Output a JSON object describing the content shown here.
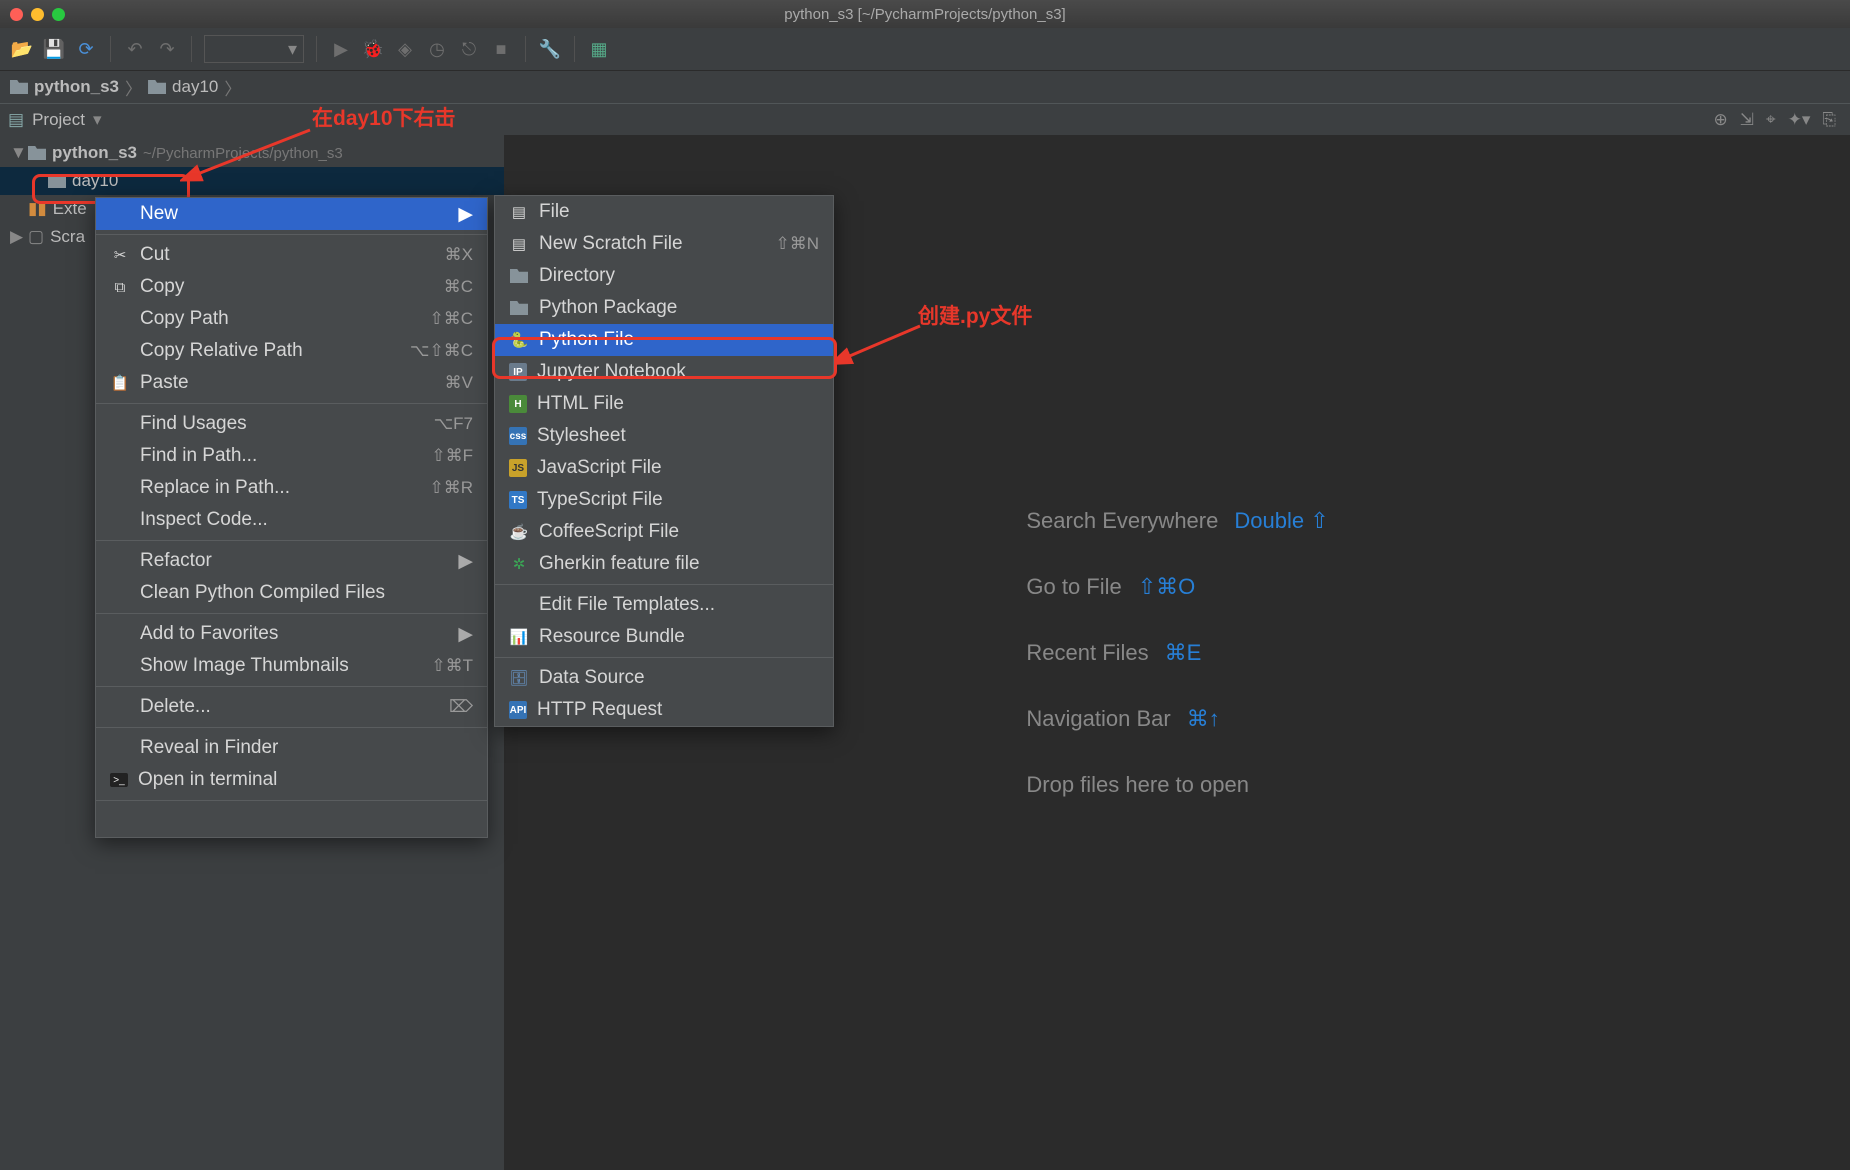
{
  "titlebar": {
    "title": "python_s3 [~/PycharmProjects/python_s3]"
  },
  "breadcrumb": {
    "root": "python_s3",
    "child": "day10"
  },
  "project_panel": {
    "label": "Project"
  },
  "tree": {
    "root": "python_s3",
    "root_path": "~/PycharmProjects/python_s3",
    "folder": "day10",
    "external": "Exte",
    "scratches": "Scra"
  },
  "context_menu": {
    "new": "New",
    "cut": {
      "label": "Cut",
      "shortcut": "⌘X"
    },
    "copy": {
      "label": "Copy",
      "shortcut": "⌘C"
    },
    "copy_path": {
      "label": "Copy Path",
      "shortcut": "⇧⌘C"
    },
    "copy_relative_path": {
      "label": "Copy Relative Path",
      "shortcut": "⌥⇧⌘C"
    },
    "paste": {
      "label": "Paste",
      "shortcut": "⌘V"
    },
    "find_usages": {
      "label": "Find Usages",
      "shortcut": "⌥F7"
    },
    "find_in_path": {
      "label": "Find in Path...",
      "shortcut": "⇧⌘F"
    },
    "replace_in_path": {
      "label": "Replace in Path...",
      "shortcut": "⇧⌘R"
    },
    "inspect_code": {
      "label": "Inspect Code..."
    },
    "refactor": {
      "label": "Refactor"
    },
    "clean_python": {
      "label": "Clean Python Compiled Files"
    },
    "add_to_favorites": {
      "label": "Add to Favorites"
    },
    "show_image_thumbnails": {
      "label": "Show Image Thumbnails",
      "shortcut": "⇧⌘T"
    },
    "delete": {
      "label": "Delete...",
      "shortcut": "⌦"
    },
    "reveal_in_finder": {
      "label": "Reveal in Finder"
    },
    "open_in_terminal": {
      "label": "Open in terminal"
    }
  },
  "new_submenu": {
    "file": "File",
    "new_scratch_file": {
      "label": "New Scratch File",
      "shortcut": "⇧⌘N"
    },
    "directory": "Directory",
    "python_package": "Python Package",
    "python_file": "Python File",
    "jupyter_notebook": "Jupyter Notebook",
    "html_file": "HTML File",
    "stylesheet": "Stylesheet",
    "javascript_file": "JavaScript File",
    "typescript_file": "TypeScript File",
    "coffeescript_file": "CoffeeScript File",
    "gherkin_feature_file": "Gherkin feature file",
    "edit_file_templates": "Edit File Templates...",
    "resource_bundle": "Resource Bundle",
    "data_source": "Data Source",
    "http_request": "HTTP Request"
  },
  "welcome": {
    "search_everywhere": "Search Everywhere",
    "search_everywhere_key": "Double ⇧",
    "go_to_file": "Go to File",
    "go_to_file_key": "⇧⌘O",
    "recent_files": "Recent Files",
    "recent_files_key": "⌘E",
    "navigation_bar": "Navigation Bar",
    "navigation_bar_key": "⌘↑",
    "drop_files": "Drop files here to open"
  },
  "annotations": {
    "right_click_on_day10": "在day10下右击",
    "create_py_file": "创建.py文件"
  }
}
